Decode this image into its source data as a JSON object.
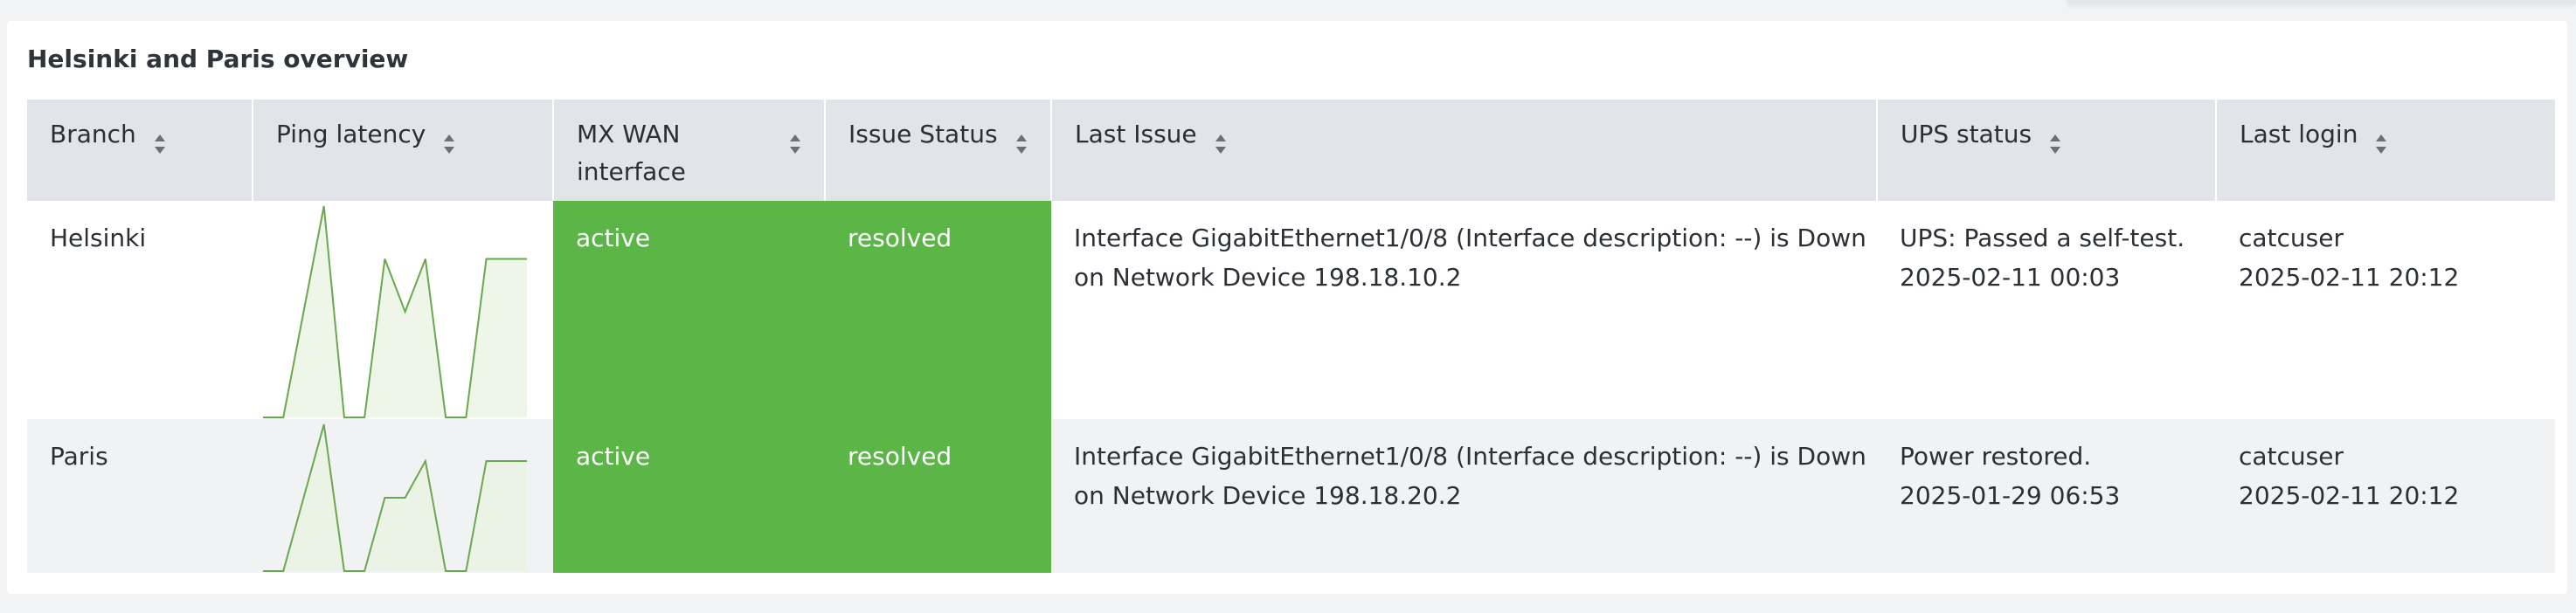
{
  "panel": {
    "title": "Helsinki and Paris overview"
  },
  "table": {
    "columns": [
      {
        "label": "Branch"
      },
      {
        "label": "Ping latency"
      },
      {
        "label": "MX WAN interface"
      },
      {
        "label": "Issue Status"
      },
      {
        "label": "Last Issue"
      },
      {
        "label": "UPS status"
      },
      {
        "label": "Last login"
      }
    ],
    "rows": [
      {
        "branch": "Helsinki",
        "ping_latency_series": [
          0,
          0,
          50,
          100,
          0,
          0,
          75,
          50,
          75,
          0,
          0,
          75,
          75,
          75
        ],
        "mx_wan": "active",
        "issue_status": "resolved",
        "last_issue_line1": "Interface GigabitEthernet1/0/8 (Interface description: --) is Down",
        "last_issue_line2": "on Network Device 198.18.10.2",
        "ups_status_line1": "UPS: Passed a self-test.",
        "ups_status_line2": "2025-02-11 00:03",
        "last_login_user": "catcuser",
        "last_login_time": "2025-02-11 20:12"
      },
      {
        "branch": "Paris",
        "ping_latency_series": [
          0,
          0,
          50,
          100,
          0,
          0,
          50,
          50,
          75,
          0,
          0,
          75,
          75,
          75
        ],
        "mx_wan": "active",
        "issue_status": "resolved",
        "last_issue_line1": "Interface GigabitEthernet1/0/8 (Interface description: --) is Down",
        "last_issue_line2": "on Network Device 198.18.20.2",
        "ups_status_line1": "Power restored.",
        "ups_status_line2": "2025-01-29 06:53",
        "last_login_user": "catcuser",
        "last_login_time": "2025-02-11 20:12"
      }
    ]
  },
  "colors": {
    "status_green": "#5cb647",
    "header_bg": "#e1e4e8",
    "sparkline_stroke": "#6aa84f",
    "sparkline_fill": "#e8f1e2"
  },
  "icons": {
    "sort": "sort-icon"
  }
}
